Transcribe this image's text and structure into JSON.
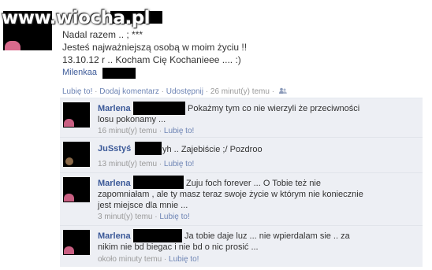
{
  "watermark": "www.wiocha.pl",
  "post": {
    "lines": [
      "Nadal razem .. ; ***",
      "Jesteś najważniejszą osobą w moim życiu !!",
      "13.10.12 r .. Kocham Cię Kochanieee .... :)"
    ],
    "author": "Milenkaa",
    "actions": {
      "like": "Lubię to!",
      "comment": "Dodaj komentarz",
      "share": "Udostępnij",
      "time": "26 minut(y) temu",
      "sep": " · "
    }
  },
  "comments": [
    {
      "author": "Marlena",
      "text_lines": [
        "Pokażmy tym co nie wierzyli że przeciwności",
        "losu pokonamy ..."
      ],
      "time": "16 minut(y) temu",
      "like": "Lubię to!"
    },
    {
      "author": "JuSstyś",
      "text_lines": [
        "yh .. Zajebiście ;/ Pozdroo"
      ],
      "time": "13 minut(y) temu",
      "like": "Lubię to!"
    },
    {
      "author": "Marlena",
      "text_lines": [
        "Zuju foch forever ... O Tobie też nie",
        "zapomniałam , ale ty masz teraz swoje życie w którym nie koniecznie",
        "jest miejsce dla mnie ..."
      ],
      "time": "3 minut(y) temu",
      "like": "Lubię to!"
    },
    {
      "author": "Marlena",
      "text_lines": [
        "Ja tobie daje luz ... nie wpierdalam sie .. za",
        "nikim nie bd biegac i nie bd o nic prosić ..."
      ],
      "time": "około minuty temu",
      "like": "Lubię to!"
    }
  ],
  "colors": {
    "link": "#3b5998",
    "muted_link": "#6d84b4",
    "comment_bg": "#edeff4",
    "redaction": "#000000"
  }
}
